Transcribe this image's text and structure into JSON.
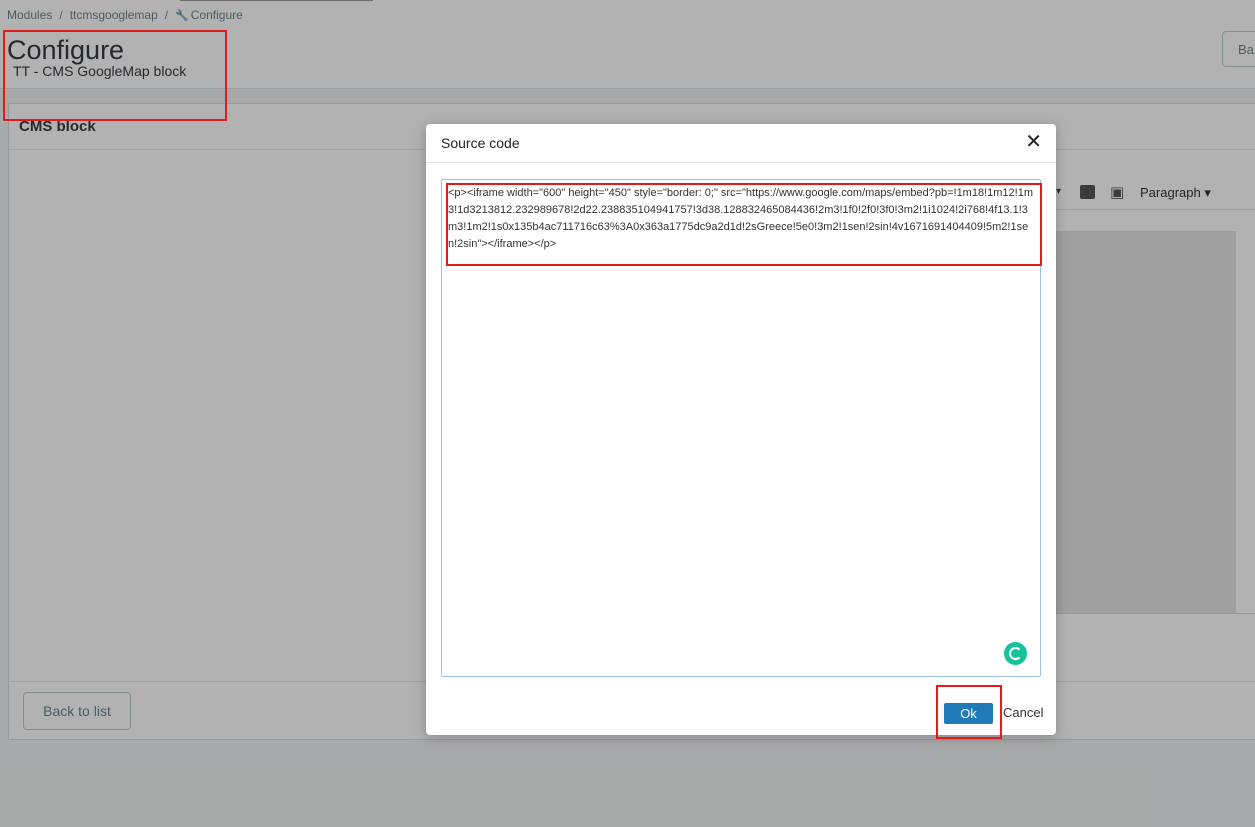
{
  "breadcrumb": {
    "items": [
      "Modules",
      "ttcmsgooglemap",
      "Configure"
    ],
    "separator": "/"
  },
  "header": {
    "title": "Configure",
    "subtitle": "TT - CMS GoogleMap block",
    "back_button_partial": "Ba"
  },
  "panel": {
    "title": "CMS block",
    "format_label": "Paragraph",
    "back_to_list_label": "Back to list"
  },
  "modal": {
    "title": "Source code",
    "close_glyph": "✕",
    "code": "<p><iframe width=\"600\" height=\"450\" style=\"border: 0;\" src=\"https://www.google.com/maps/embed?pb=!1m18!1m12!1m3!1d3213812.232989678!2d22.238835104941757!3d38.128832465084436!2m3!1f0!2f0!3f0!3m2!1i1024!2i768!4f13.1!3m3!1m2!1s0x135b4ac711716c63%3A0x363a1775dc9a2d1d!2sGreece!5e0!3m2!1sen!2sin!4v1671691404409!5m2!1sen!2sin\"></iframe></p>",
    "ok_label": "Ok",
    "cancel_label": "Cancel"
  },
  "colors": {
    "annotation": "#e31b1b",
    "primary_button": "#207ab7",
    "grammarly": "#15c39a"
  },
  "icons": [
    "wrench-icon",
    "caret-down-icon",
    "image-icon",
    "media-icon",
    "close-icon",
    "grammarly-icon"
  ]
}
